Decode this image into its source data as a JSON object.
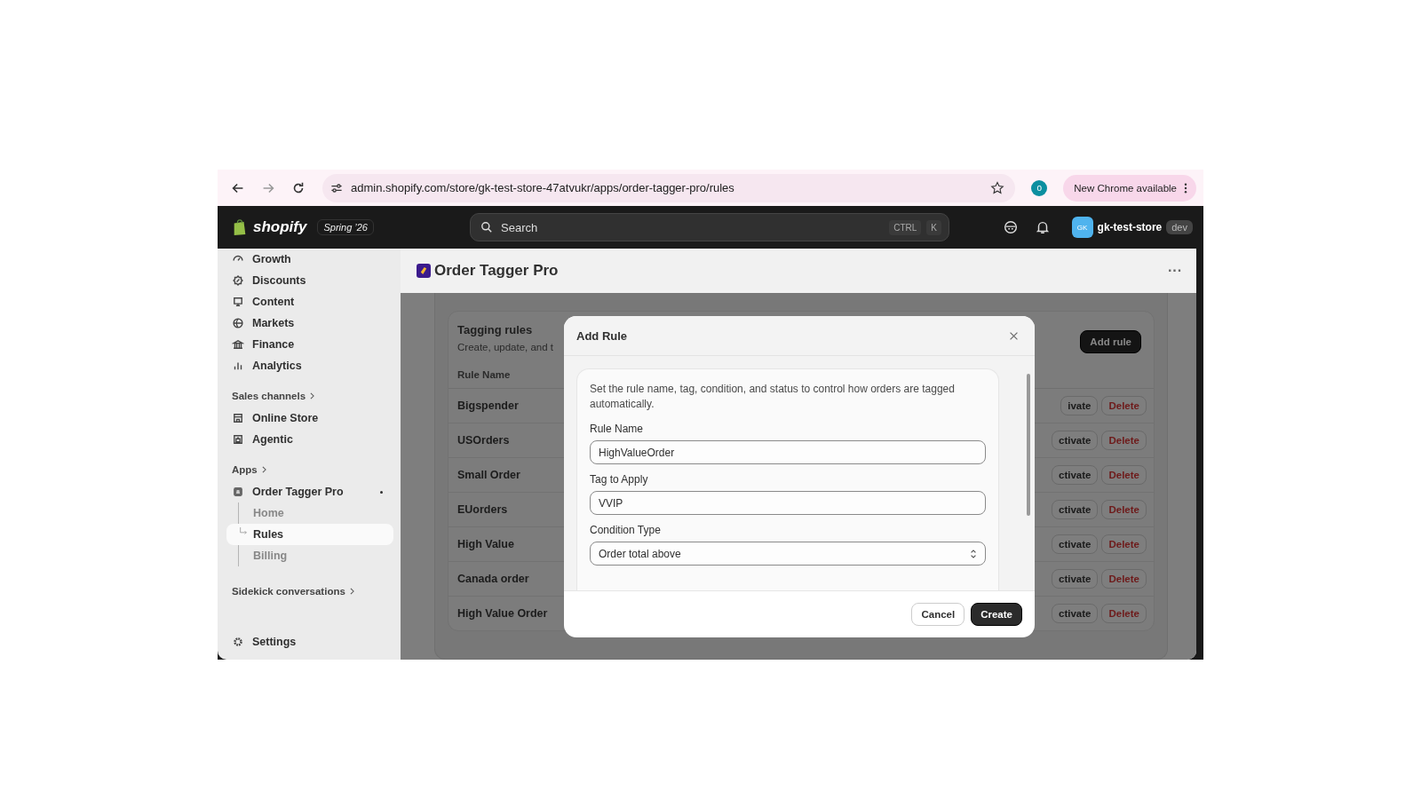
{
  "browser": {
    "url": "admin.shopify.com/store/gk-test-store-47atvukr/apps/order-tagger-pro/rules",
    "profile_initial": "o",
    "update_button": "New Chrome available"
  },
  "topbar": {
    "logo": "shopify",
    "badge": "Spring ’26",
    "search_placeholder": "Search",
    "shortcut": [
      "CTRL",
      "K"
    ],
    "avatar": "GK",
    "store": "gk-test-store",
    "store_badge": "dev"
  },
  "sidebar": {
    "items": [
      {
        "label": "Growth",
        "selected": false
      },
      {
        "label": "Discounts",
        "selected": false
      },
      {
        "label": "Content",
        "selected": false
      },
      {
        "label": "Markets",
        "selected": false
      },
      {
        "label": "Finance",
        "selected": false
      },
      {
        "label": "Analytics",
        "selected": false
      }
    ],
    "sales_channels": {
      "label": "Sales channels",
      "items": [
        {
          "label": "Online Store",
          "selected": false
        },
        {
          "label": "Agentic",
          "selected": false
        }
      ]
    },
    "apps": {
      "label": "Apps",
      "items": [
        {
          "label": "Order Tagger Pro",
          "selected": false,
          "children": [
            {
              "label": "Home",
              "selected": false
            },
            {
              "label": "Rules",
              "selected": true
            },
            {
              "label": "Billing",
              "selected": false
            }
          ]
        }
      ]
    },
    "sidekick": {
      "label": "Sidekick conversations"
    },
    "settings": {
      "label": "Settings",
      "selected": false
    }
  },
  "page": {
    "title": "Order Tagger Pro",
    "more": "···"
  },
  "card": {
    "title": "Tagging rules",
    "description": "Create, update, and t",
    "add_button": "Add rule",
    "columns": [
      "Rule Name"
    ],
    "rows": [
      {
        "name": "Bigspender",
        "action_1": "ivate",
        "action_2": "Delete"
      },
      {
        "name": "USOrders",
        "action_1": "ctivate",
        "action_2": "Delete"
      },
      {
        "name": "Small Order",
        "action_1": "ctivate",
        "action_2": "Delete"
      },
      {
        "name": "EUorders",
        "action_1": "ctivate",
        "action_2": "Delete"
      },
      {
        "name": "High Value",
        "action_1": "ctivate",
        "action_2": "Delete"
      },
      {
        "name": "Canada order",
        "action_1": "ctivate",
        "action_2": "Delete"
      },
      {
        "name": "High Value Order",
        "action_1": "ctivate",
        "action_2": "Delete"
      }
    ]
  },
  "modal": {
    "title": "Add Rule",
    "description": "Set the rule name, tag, condition, and status to control how orders are tagged automatically.",
    "fields": [
      {
        "kind": "text",
        "label": "Rule Name",
        "value": "HighValueOrder"
      },
      {
        "kind": "text",
        "label": "Tag to Apply",
        "value": "VVIP"
      },
      {
        "kind": "select",
        "label": "Condition Type",
        "value": "Order total above"
      }
    ],
    "buttons": [
      {
        "kind": "secondary",
        "label": "Cancel"
      },
      {
        "kind": "primary",
        "label": "Create"
      }
    ]
  }
}
